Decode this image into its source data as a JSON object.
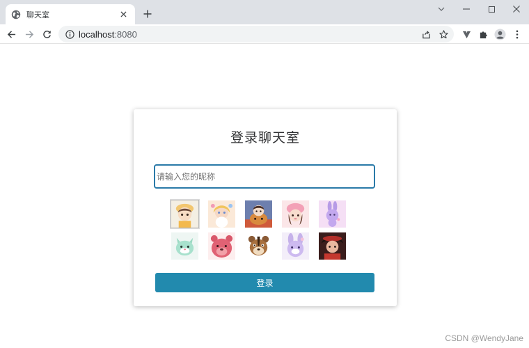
{
  "browser": {
    "tab_title": "聊天室",
    "url_host": "localhost",
    "url_port": ":8080",
    "icons": [
      "globe-icon",
      "close-icon",
      "plus-icon",
      "chevron-down-icon",
      "minimize-icon",
      "maximize-icon",
      "window-close-icon",
      "back-arrow-icon",
      "forward-arrow-icon",
      "reload-icon",
      "info-icon",
      "share-icon",
      "star-icon",
      "vuetify-extension-icon",
      "puzzle-icon",
      "profile-icon",
      "kebab-menu-icon"
    ]
  },
  "login": {
    "title": "登录聊天室",
    "nickname_placeholder": "请输入您的昵称",
    "nickname_value": "",
    "submit_label": "登录",
    "selected_avatar": 1,
    "avatars": [
      {
        "name": "avatar-1"
      },
      {
        "name": "avatar-2"
      },
      {
        "name": "avatar-3"
      },
      {
        "name": "avatar-4"
      },
      {
        "name": "avatar-5"
      },
      {
        "name": "avatar-6"
      },
      {
        "name": "avatar-7"
      },
      {
        "name": "avatar-8"
      },
      {
        "name": "avatar-9"
      },
      {
        "name": "avatar-10"
      }
    ]
  },
  "colors": {
    "accent": "#228aae",
    "input_border": "#2a7aa8",
    "tabbar_bg": "#dee1e6"
  },
  "watermark": "CSDN @WendyJane"
}
